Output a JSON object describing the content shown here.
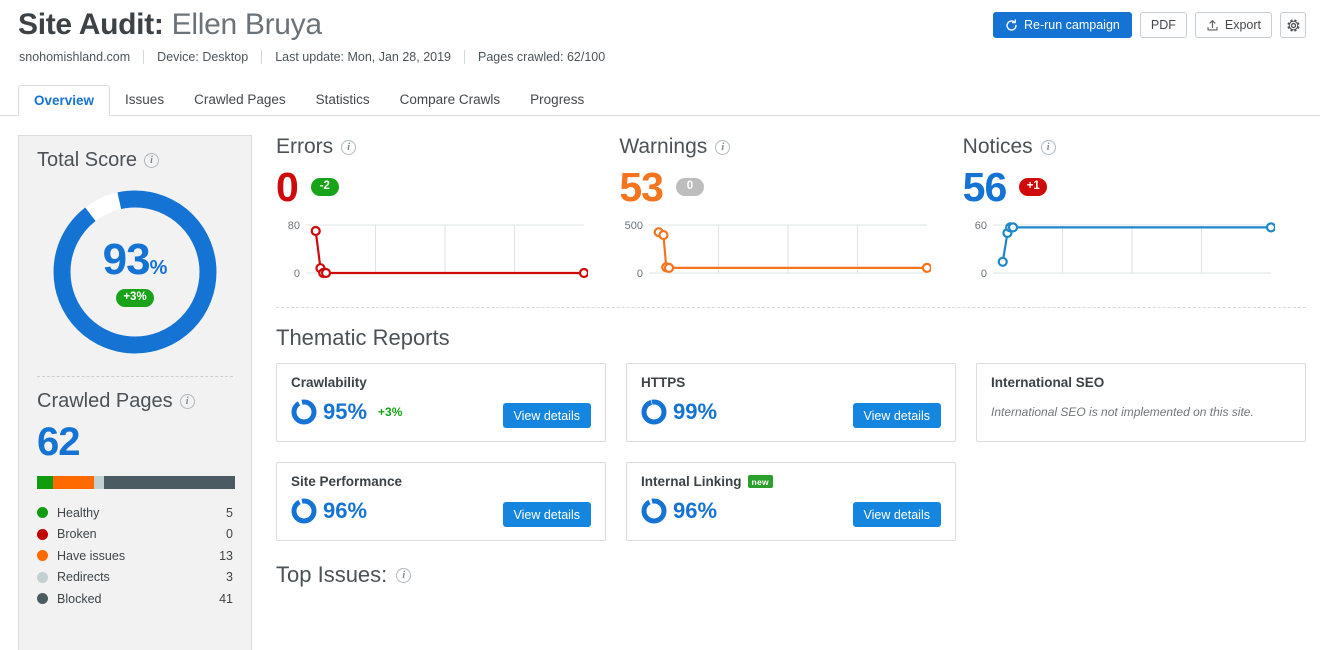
{
  "header": {
    "title_prefix": "Site Audit:",
    "title_name": "Ellen Bruya",
    "meta": [
      {
        "name": "domain",
        "text": "snohomishland.com"
      },
      {
        "name": "device",
        "text": "Device: Desktop"
      },
      {
        "name": "last-update",
        "text": "Last update: Mon, Jan 28, 2019"
      },
      {
        "name": "pages-crawled",
        "text": "Pages crawled: 62/100"
      }
    ],
    "actions": {
      "rerun_label": "Re-run campaign",
      "pdf_label": "PDF",
      "export_label": "Export",
      "settings_icon": "gear-icon",
      "rerun_icon": "refresh-icon",
      "export_icon": "upload-icon",
      "primary_color": "#1573d4"
    }
  },
  "tabs": [
    {
      "label": "Overview",
      "active": true
    },
    {
      "label": "Issues",
      "active": false
    },
    {
      "label": "Crawled Pages",
      "active": false
    },
    {
      "label": "Statistics",
      "active": false
    },
    {
      "label": "Compare Crawls",
      "active": false
    },
    {
      "label": "Progress",
      "active": false
    }
  ],
  "sidebar": {
    "total_score": {
      "title": "Total Score",
      "info_icon": "info-icon",
      "value": "93",
      "unit": "%",
      "delta": "+3%",
      "delta_color": "#18a318",
      "ring_color": "#1573d4",
      "ring_pct": 93
    },
    "crawled_pages": {
      "title": "Crawled Pages",
      "info_icon": "info-icon",
      "value": "62",
      "bar": [
        {
          "label": "Healthy",
          "value": 5,
          "color": "#0f9d0f"
        },
        {
          "label": "Broken",
          "value": 0,
          "color": "#c00000"
        },
        {
          "label": "Have issues",
          "value": 13,
          "color": "#ff6a00"
        },
        {
          "label": "Redirects",
          "value": 3,
          "color": "#c3d0d2"
        },
        {
          "label": "Blocked",
          "value": 41,
          "color": "#4a5b61"
        }
      ],
      "legend": [
        {
          "label": "Healthy",
          "value": "5",
          "color": "#0f9d0f"
        },
        {
          "label": "Broken",
          "value": "0",
          "color": "#c00000"
        },
        {
          "label": "Have issues",
          "value": "13",
          "color": "#ff6a00"
        },
        {
          "label": "Redirects",
          "value": "3",
          "color": "#c3d0d2"
        },
        {
          "label": "Blocked",
          "value": "41",
          "color": "#4a5b61"
        }
      ]
    }
  },
  "summary": [
    {
      "title": "Errors",
      "info_icon": "info-icon",
      "value": "0",
      "value_color": "#cf0a0a",
      "badge": "-2",
      "badge_kind": "green"
    },
    {
      "title": "Warnings",
      "info_icon": "info-icon",
      "value": "53",
      "value_color": "#f5741e",
      "badge": "0",
      "badge_kind": "gray"
    },
    {
      "title": "Notices",
      "info_icon": "info-icon",
      "value": "56",
      "value_color": "#1573d4",
      "badge": "+1",
      "badge_kind": "red"
    }
  ],
  "chart_data": [
    {
      "type": "line",
      "title": "Errors",
      "color": "#cf0a0a",
      "ylabel": "",
      "xlabel": "",
      "ylim": [
        0,
        80
      ],
      "ytick_labels": [
        "80",
        "0"
      ],
      "grid": true,
      "x": [
        0,
        1,
        2,
        3,
        4
      ],
      "values": [
        70,
        8,
        0,
        0,
        0
      ],
      "markers": true
    },
    {
      "type": "line",
      "title": "Warnings",
      "color": "#f5741e",
      "ylabel": "",
      "xlabel": "",
      "ylim": [
        0,
        500
      ],
      "ytick_labels": [
        "500",
        "0"
      ],
      "grid": true,
      "x": [
        0,
        1,
        2,
        3,
        4
      ],
      "values": [
        425,
        395,
        60,
        53,
        53
      ],
      "markers": true
    },
    {
      "type": "line",
      "title": "Notices",
      "color": "#1d87c9",
      "ylabel": "",
      "xlabel": "",
      "ylim": [
        0,
        60
      ],
      "ytick_labels": [
        "60",
        "0"
      ],
      "grid": true,
      "x": [
        0,
        1,
        2,
        3,
        4
      ],
      "values": [
        14,
        50,
        57,
        57,
        57
      ],
      "markers": true
    }
  ],
  "thematic": {
    "section_title": "Thematic Reports",
    "view_details_label": "View details",
    "cards": [
      {
        "title": "Crawlability",
        "pct": "95%",
        "pct_value": 95,
        "delta": "+3%",
        "has_button": true,
        "badge": "",
        "note": ""
      },
      {
        "title": "HTTPS",
        "pct": "99%",
        "pct_value": 99,
        "delta": "",
        "has_button": true,
        "badge": "",
        "note": ""
      },
      {
        "title": "International SEO",
        "pct": "",
        "pct_value": 0,
        "delta": "",
        "has_button": false,
        "badge": "",
        "note": "International SEO is not implemented on this site."
      },
      {
        "title": "Site Performance",
        "pct": "96%",
        "pct_value": 96,
        "delta": "",
        "has_button": true,
        "badge": "",
        "note": ""
      },
      {
        "title": "Internal Linking",
        "pct": "96%",
        "pct_value": 96,
        "delta": "",
        "has_button": true,
        "badge": "new",
        "note": ""
      }
    ]
  },
  "top_issues": {
    "title": "Top Issues:",
    "info_icon": "info-icon"
  }
}
